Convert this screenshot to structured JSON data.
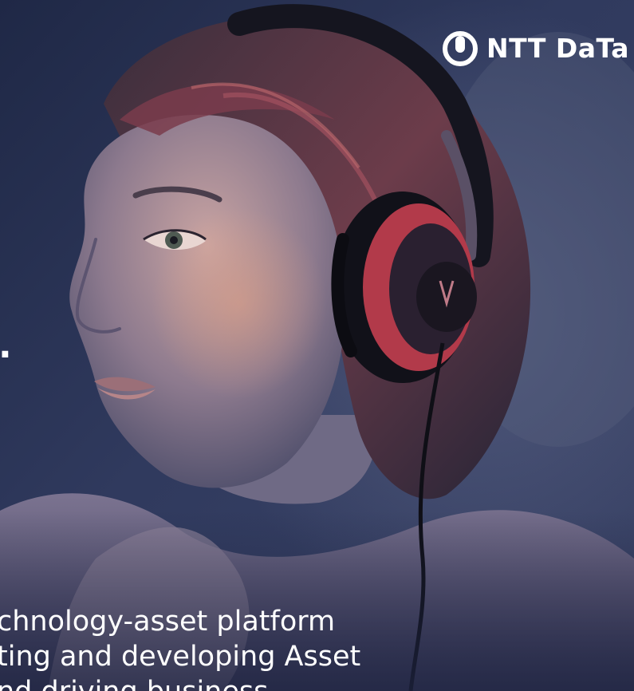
{
  "brand": {
    "name": "NTT Data",
    "logo_text": "NTT DaTa",
    "icon": "ntt-data-logo-mark"
  },
  "headline": {
    "fragment": "."
  },
  "body": {
    "lines": [
      "chnology-asset platform",
      "ting and developing Asset",
      "nd driving business"
    ]
  },
  "photo": {
    "subject": "woman-with-headphones"
  },
  "colors": {
    "background": "#28304f",
    "text": "#ffffff",
    "headphone_accent": "#b23a4a"
  }
}
